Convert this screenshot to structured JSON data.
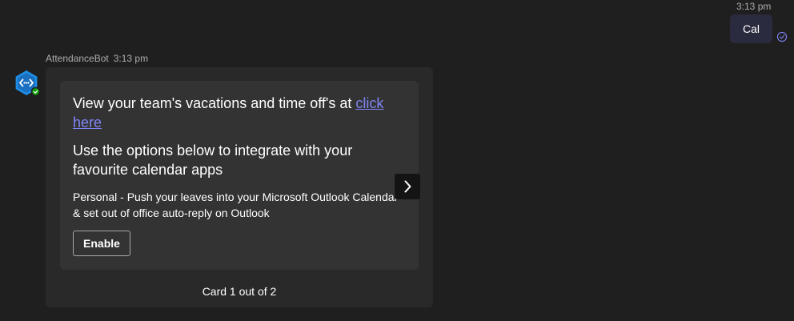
{
  "outgoing": {
    "time": "3:13 pm",
    "message": "Cal"
  },
  "bot": {
    "sender": "AttendanceBot",
    "time": "3:13 pm",
    "card": {
      "title": "View your team's vacations and time off's at ",
      "link_text": "click here",
      "subtitle": "Use the options below to integrate with your favourite calendar apps",
      "description": "Personal - Push your leaves into your Microsoft Outlook Calendar & set out of office auto-reply on Outlook",
      "button_label": "Enable"
    },
    "counter": "Card 1 out of 2"
  },
  "icons": {
    "avatar": "bot-avatar-icon",
    "read_receipt": "read-receipt-icon",
    "next": "chevron-right-icon"
  },
  "colors": {
    "background": "#1f1f1f",
    "bubble": "#292929",
    "card": "#333333",
    "link": "#7f85f5",
    "outgoing_bubble": "#2b2b40",
    "status_online": "#13a10e",
    "avatar_blue": "#1e8fe6"
  }
}
